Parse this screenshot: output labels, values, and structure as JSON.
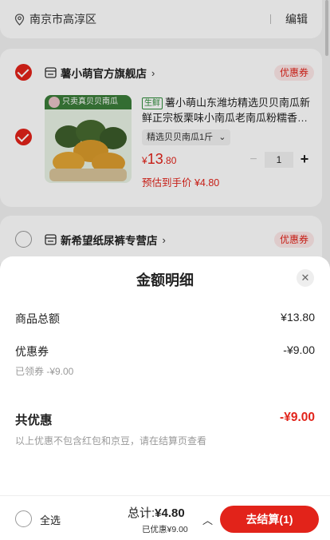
{
  "address": {
    "text": "南京市高淳区",
    "edit_label": "编辑",
    "pin_icon": "location-pin-icon"
  },
  "stores": [
    {
      "name": "薯小萌官方旗舰店",
      "arrow": "›",
      "coupon_label": "优惠券",
      "checked": true,
      "product": {
        "image_label": "只卖真贝贝南瓜",
        "fresh_tag": "生鲜",
        "title": "薯小萌山东潍坊精选贝贝南瓜新鲜正宗板栗味小南瓜老南瓜粉糯香…",
        "spec": "精选贝贝南瓜1斤",
        "spec_caret": "⌄",
        "price_currency": "¥",
        "price_int": "13",
        "price_dec": ".80",
        "estimate": "预估到手价 ¥4.80",
        "quantity": "1",
        "minus": "−",
        "plus": "+"
      }
    },
    {
      "name": "新希望纸尿裤专营店",
      "arrow": "›",
      "coupon_label": "优惠券",
      "checked": false
    }
  ],
  "sheet": {
    "title": "金额明细",
    "close": "✕",
    "rows": [
      {
        "label": "商品总额",
        "value": "¥13.80"
      },
      {
        "label": "优惠券",
        "value": "-¥9.00"
      }
    ],
    "coupon_note": "已领券 -¥9.00",
    "total_discount_label": "共优惠",
    "total_discount_value": "-¥9.00",
    "discount_note": "以上优惠不包含红包和京豆，请在结算页查看"
  },
  "bottom_bar": {
    "select_all": "全选",
    "total_label": "总计:",
    "total_value": "¥4.80",
    "saved": "已优惠¥9.00",
    "caret": "︿",
    "checkout": "去结算(1)"
  },
  "colors": {
    "accent": "#e2231a",
    "background": "#f2f2f2"
  }
}
